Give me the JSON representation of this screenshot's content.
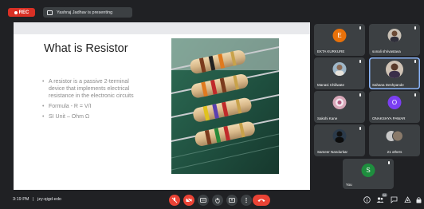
{
  "topbar": {
    "rec_label": "REC",
    "presenting_text": "Yashraj Jadhav is presenting"
  },
  "slide": {
    "title": "What is Resistor",
    "bullets": [
      "A resistor is a passive 2-terminal device that implements electrical resistance in the electronic circuits",
      "Formula -  R = V/I",
      "SI Unit – Ohm Ω"
    ]
  },
  "participants": [
    {
      "name": "EKTA KURKURE",
      "initial": "E",
      "color": "#e8710a"
    },
    {
      "name": "sonali shrivastava",
      "initial": "",
      "color": "#c8c0b5"
    },
    {
      "name": "Manasi Chiliwate",
      "initial": "",
      "color": "#9fb7c8"
    },
    {
      "name": "Sahana Deshpande",
      "initial": "",
      "color": "#d0c3b5"
    },
    {
      "name": "Sakshi Kane",
      "initial": "",
      "color": "#d7a7b8"
    },
    {
      "name": "ONAKSHYA PAWAR",
      "initial": "O",
      "color": "#7b3ff2"
    },
    {
      "name": "Sameer Nandurkar",
      "initial": "",
      "color": "#2b3a4a"
    },
    {
      "name": "21 others",
      "initial": "",
      "color": "#a0a0a0"
    },
    {
      "name": "You",
      "initial": "S",
      "color": "#1e8e3e"
    }
  ],
  "bottombar": {
    "time": "3:19 PM",
    "separator": "|",
    "meeting_code": "jzy-qigd-edo",
    "people_count": "28"
  },
  "colors": {
    "background": "#202124",
    "tile": "#3c4043",
    "danger": "#ea4335",
    "accent": "#8ab4f8"
  },
  "icons": {
    "mic_off": "mic-off-icon",
    "camera_off": "camera-off-icon",
    "captions": "captions-icon",
    "raise_hand": "raise-hand-icon",
    "present": "present-icon",
    "more": "more-options-icon",
    "leave": "leave-call-icon",
    "info": "info-icon",
    "people": "people-icon",
    "chat": "chat-icon",
    "activities": "activities-icon",
    "lock": "host-controls-icon"
  }
}
